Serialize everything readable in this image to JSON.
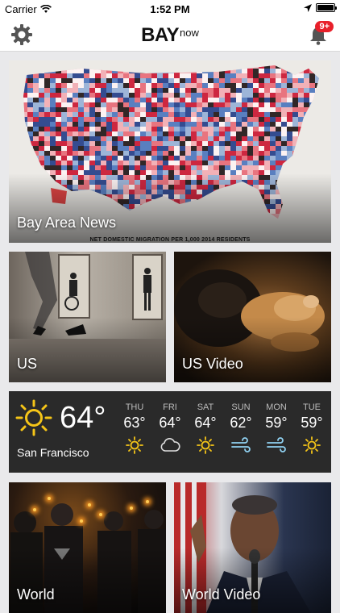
{
  "status_bar": {
    "carrier": "Carrier",
    "time": "1:52 PM"
  },
  "nav": {
    "logo_main": "BAY",
    "logo_sup": "now",
    "notification_badge": "9+"
  },
  "tiles": {
    "hero": {
      "caption": "Bay Area News",
      "map_note": "NET DOMESTIC MIGRATION PER 1,000 2014 RESIDENTS"
    },
    "us": {
      "caption": "US"
    },
    "us_video": {
      "caption": "US Video"
    },
    "world": {
      "caption": "World"
    },
    "world_video": {
      "caption": "World Video"
    }
  },
  "weather": {
    "current_temp": "64°",
    "city": "San Francisco",
    "current_icon": "sun-icon",
    "forecast": [
      {
        "day": "THU",
        "temp": "63°",
        "icon": "sun-icon"
      },
      {
        "day": "FRI",
        "temp": "64°",
        "icon": "cloud-icon"
      },
      {
        "day": "SAT",
        "temp": "64°",
        "icon": "sun-icon"
      },
      {
        "day": "SUN",
        "temp": "62°",
        "icon": "wind-icon"
      },
      {
        "day": "MON",
        "temp": "59°",
        "icon": "wind-icon"
      },
      {
        "day": "TUE",
        "temp": "59°",
        "icon": "sun-icon"
      }
    ]
  },
  "colors": {
    "badge": "#e8202a",
    "sun": "#f5c518",
    "weather_bg": "#2a2a2a"
  }
}
